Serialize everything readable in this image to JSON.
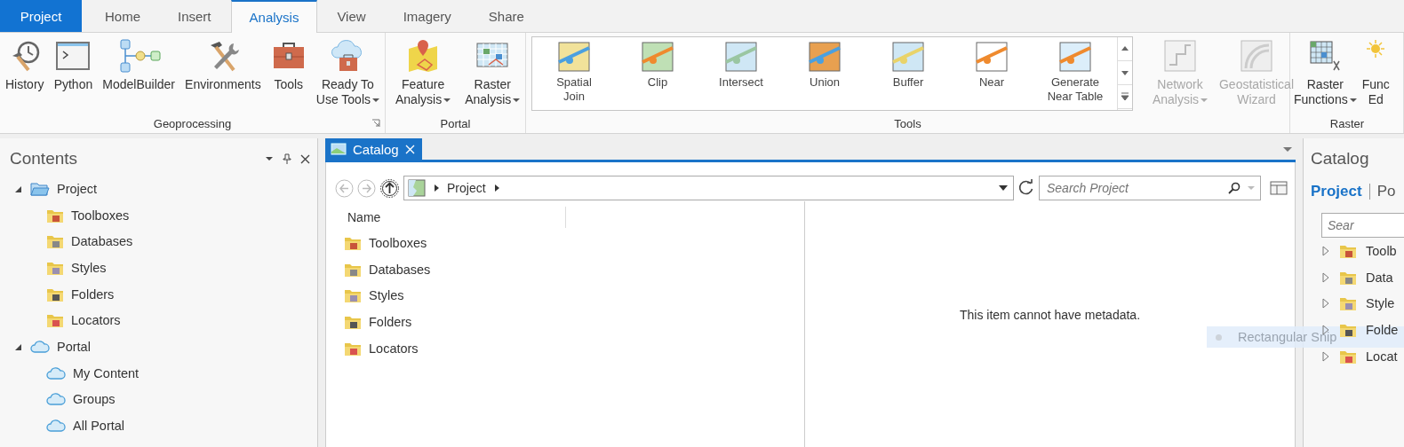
{
  "tabs": [
    {
      "label": "Project",
      "kind": "file",
      "selected": false
    },
    {
      "label": "Home",
      "kind": "tab",
      "selected": false
    },
    {
      "label": "Insert",
      "kind": "tab",
      "selected": false
    },
    {
      "label": "Analysis",
      "kind": "tab",
      "selected": true
    },
    {
      "label": "View",
      "kind": "tab",
      "selected": false
    },
    {
      "label": "Imagery",
      "kind": "tab",
      "selected": false
    },
    {
      "label": "Share",
      "kind": "tab",
      "selected": false
    }
  ],
  "ribbon": {
    "groups": [
      {
        "label": "Geoprocessing",
        "launcher": true,
        "buttons": [
          {
            "lines": [
              "History"
            ],
            "dropdown": false,
            "disabled": false
          },
          {
            "lines": [
              "Python"
            ],
            "dropdown": false,
            "disabled": false
          },
          {
            "lines": [
              "ModelBuilder"
            ],
            "dropdown": false,
            "disabled": false
          },
          {
            "lines": [
              "Environments"
            ],
            "dropdown": false,
            "disabled": false
          },
          {
            "lines": [
              "Tools"
            ],
            "dropdown": false,
            "disabled": false
          },
          {
            "lines": [
              "Ready To",
              "Use Tools"
            ],
            "dropdown": true,
            "disabled": false
          }
        ]
      },
      {
        "label": "Portal",
        "buttons": [
          {
            "lines": [
              "Feature",
              "Analysis"
            ],
            "dropdown": true,
            "disabled": false
          },
          {
            "lines": [
              "Raster",
              "Analysis"
            ],
            "dropdown": true,
            "disabled": false
          }
        ]
      },
      {
        "label": "Tools",
        "gallery": [
          {
            "lines": [
              "Spatial",
              "Join"
            ]
          },
          {
            "lines": [
              "Clip"
            ]
          },
          {
            "lines": [
              "Intersect"
            ]
          },
          {
            "lines": [
              "Union"
            ]
          },
          {
            "lines": [
              "Buffer"
            ]
          },
          {
            "lines": [
              "Near"
            ]
          },
          {
            "lines": [
              "Generate",
              "Near Table"
            ]
          }
        ],
        "buttons": [
          {
            "lines": [
              "Network",
              "Analysis"
            ],
            "dropdown": true,
            "disabled": true
          },
          {
            "lines": [
              "Geostatistical",
              "Wizard"
            ],
            "dropdown": false,
            "disabled": true
          }
        ]
      },
      {
        "label": "Raster",
        "buttons": [
          {
            "lines": [
              "Raster",
              "Functions"
            ],
            "dropdown": true,
            "disabled": false
          },
          {
            "lines": [
              "Func",
              "Ed"
            ],
            "dropdown": false,
            "disabled": false
          }
        ]
      }
    ]
  },
  "contents": {
    "title": "Contents",
    "tree": [
      {
        "label": "Project",
        "expanded": true,
        "children": [
          {
            "label": "Toolboxes"
          },
          {
            "label": "Databases"
          },
          {
            "label": "Styles"
          },
          {
            "label": "Folders"
          },
          {
            "label": "Locators"
          }
        ]
      },
      {
        "label": "Portal",
        "expanded": true,
        "children": [
          {
            "label": "My Content"
          },
          {
            "label": "Groups"
          },
          {
            "label": "All Portal"
          }
        ]
      }
    ]
  },
  "catalog_view": {
    "tab": {
      "label": "Catalog",
      "selected": true
    },
    "breadcrumb": [
      "Project"
    ],
    "search": {
      "placeholder": "Search Project"
    },
    "columns": [
      "Name"
    ],
    "items": [
      "Toolboxes",
      "Databases",
      "Styles",
      "Folders",
      "Locators"
    ],
    "message": "This item cannot have metadata."
  },
  "catalog_pane": {
    "title": "Catalog",
    "tabs": [
      {
        "label": "Project",
        "selected": true
      },
      {
        "label": "Po",
        "selected": false
      }
    ],
    "search": {
      "placeholder": "Sear"
    },
    "items": [
      {
        "label": "Toolb",
        "expanded": false
      },
      {
        "label": "Data",
        "expanded": false
      },
      {
        "label": "Style",
        "expanded": false
      },
      {
        "label": "Folde",
        "expanded": false
      },
      {
        "label": "Locat",
        "expanded": false
      }
    ]
  },
  "snip_hint": "Rectangular Snip"
}
